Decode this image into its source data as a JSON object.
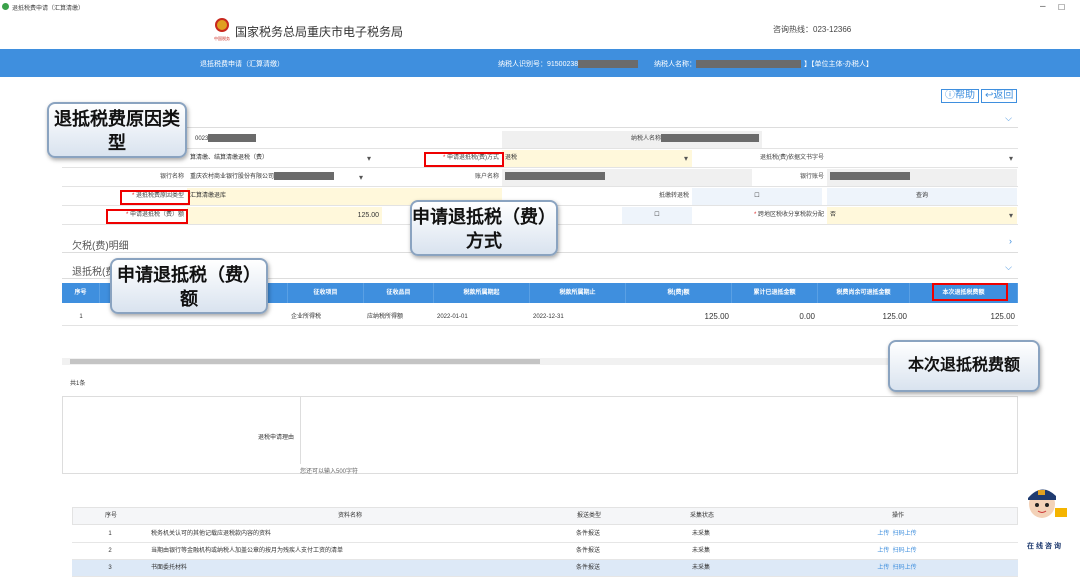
{
  "window": {
    "title": "退抵税费申请（汇算清缴）"
  },
  "header": {
    "site_title": "国家税务总局重庆市电子税务局",
    "hotline": "咨询热线：023-12366",
    "emblem_text": "中国税务"
  },
  "bluebar": {
    "page_name": "退抵税费申请（汇算清缴）",
    "taxpayer_id_label": "纳税人识别号：91500238",
    "taxpayer_name_label": "纳税人名称：",
    "role": "】【单位主体-办税人】"
  },
  "toolbar": {
    "help": "帮助",
    "back": "返回"
  },
  "form": {
    "taxpayer_id_partial": "0023",
    "taxpayer_name_label": "纳税人名称",
    "refund_reason_select": "算清缴、结算清缴退税（费）",
    "refund_method_label": "申请退抵税(费)方式",
    "refund_method_value": "退税",
    "refund_doc_label": "退抵税(费)依据文书字号",
    "bank_label": "银行名称",
    "bank_value": "重庆农村商业银行股份有限公司",
    "account_name_label": "账户名称",
    "account_no_label": "银行账号",
    "reason_type_label": "退抵税费原因类型",
    "reason_type_value": "汇算清缴退库",
    "offset_label": "抵缴转退税",
    "query_label": "查询",
    "amount_label": "申请退抵税（费）额",
    "amount_value": "125.00",
    "cross_region_label": "跨地区税收分享税款分配",
    "cross_region_value": "否",
    "required_mark": "*"
  },
  "sections": {
    "arrears": "欠税(费)明细",
    "refund_detail": "退抵税(费"
  },
  "table": {
    "headers": [
      "序号",
      "",
      "",
      "征收项目",
      "征收品目",
      "税款所属期起",
      "税款所属期止",
      "税(费)额",
      "累计已退抵金额",
      "税费尚余可退抵金额",
      "本次退抵税费额"
    ],
    "rows": [
      [
        "1",
        "",
        "",
        "企业所得税",
        "应纳税所得额",
        "2022-01-01",
        "2022-12-31",
        "125.00",
        "0.00",
        "125.00",
        "125.00"
      ]
    ],
    "total": "共1条"
  },
  "reason": {
    "label": "退税申请理由",
    "hint": "您还可以输入500字符"
  },
  "docs": {
    "headers": [
      "序号",
      "资料名称",
      "报送类型",
      "采集状态",
      "操作"
    ],
    "rows": [
      {
        "no": "1",
        "name": "税务机关认可的其他记载应退税款内容的资料",
        "type": "条件报送",
        "status": "未采集",
        "op1": "上传",
        "op2": "扫码上传"
      },
      {
        "no": "2",
        "name": "当期由银行等金融机构或纳税人加盖公章的按月为残疾人支付工资的清单",
        "type": "条件报送",
        "status": "未采集",
        "op1": "上传",
        "op2": "扫码上传"
      },
      {
        "no": "3",
        "name": "书面委托材料",
        "type": "条件报送",
        "status": "未采集",
        "op1": "上传",
        "op2": "扫码上传"
      }
    ]
  },
  "callouts": {
    "reason_type": "退抵税费原因类型",
    "method": "申请退抵税（费）方式",
    "amount": "申请退抵税（费）额",
    "current": "本次退抵税费额"
  },
  "assistant": {
    "label": "在线咨询"
  }
}
